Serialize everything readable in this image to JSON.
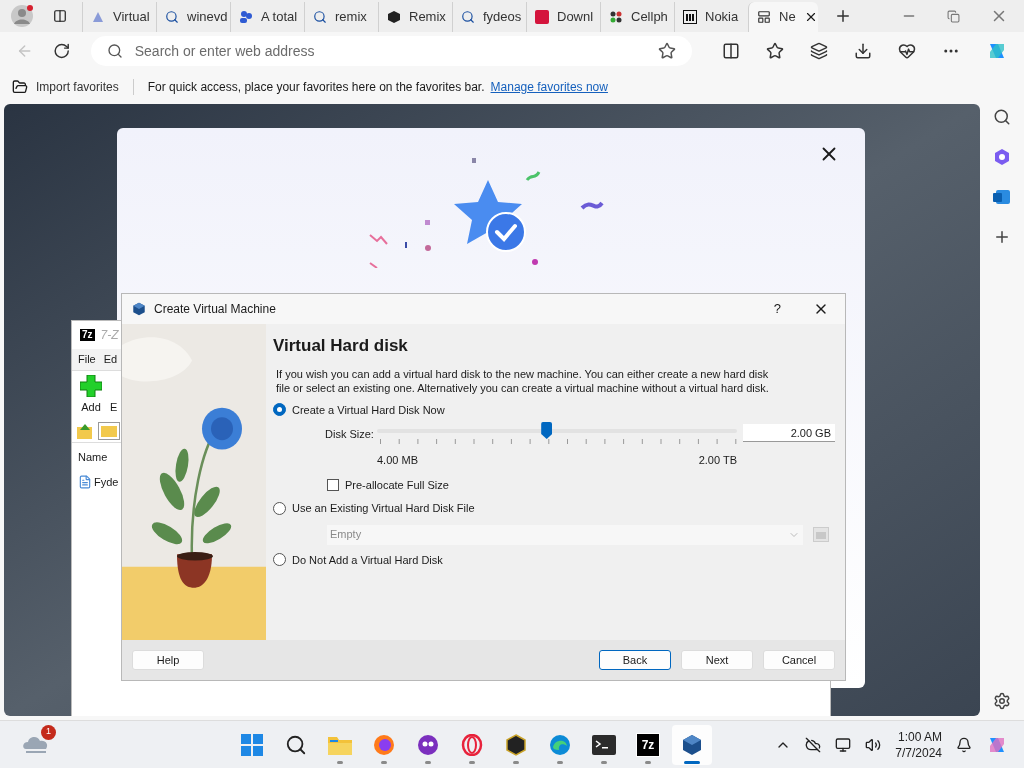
{
  "browser": {
    "tabs": [
      {
        "label": "Virtual",
        "kind": "page",
        "selected": false
      },
      {
        "label": "winevd",
        "kind": "search",
        "selected": false
      },
      {
        "label": "A total",
        "kind": "people",
        "selected": false
      },
      {
        "label": "remix",
        "kind": "search",
        "selected": false
      },
      {
        "label": "Remix",
        "kind": "cube",
        "selected": false
      },
      {
        "label": "fydeos",
        "kind": "search",
        "selected": false
      },
      {
        "label": "Downl",
        "kind": "brand",
        "selected": false
      },
      {
        "label": "Cellph",
        "kind": "dots",
        "selected": false
      },
      {
        "label": "Nokia",
        "kind": "columns",
        "selected": false
      },
      {
        "label": "Ne",
        "kind": "window",
        "selected": true
      }
    ],
    "address": {
      "placeholder": "Search or enter web address"
    },
    "favorites_bar": {
      "import": "Import favorites",
      "message": "For quick access, place your favorites here on the favorites bar.",
      "link": "Manage favorites now"
    }
  },
  "zip_window": {
    "logo": "7z",
    "title": "7-Z",
    "menu": [
      "File",
      "Ed"
    ],
    "toolbar": [
      "Add",
      "E"
    ],
    "column": "Name",
    "file": "Fyde"
  },
  "dialog": {
    "title": "Create Virtual Machine",
    "help_mark": "?",
    "heading": "Virtual Hard disk",
    "description": "If you wish you can add a virtual hard disk to the new machine. You can either create a new hard disk file or select an existing one. Alternatively you can create a virtual machine without a virtual hard disk.",
    "options": [
      {
        "label": "Create a Virtual Hard Disk Now",
        "selected": true
      },
      {
        "label": "Use an Existing Virtual Hard Disk File",
        "selected": false
      },
      {
        "label": "Do Not Add a Virtual Hard Disk",
        "selected": false
      }
    ],
    "disk_size": {
      "label": "Disk Size:",
      "level": 0.47,
      "min": "4.00 MB",
      "max": "2.00 TB",
      "value": "2.00 GB"
    },
    "preallocate": {
      "label": "Pre-allocate Full Size",
      "checked": false
    },
    "existing_file": {
      "value": "Empty",
      "disabled": true
    },
    "buttons": [
      {
        "label": "Help",
        "default": false
      },
      {
        "label": "Back",
        "default": true
      },
      {
        "label": "Next",
        "default": false
      },
      {
        "label": "Cancel",
        "default": false
      }
    ]
  },
  "taskbar": {
    "weather_badge": "1",
    "apps": [
      {
        "kind": "windows",
        "selected": false
      },
      {
        "kind": "search",
        "selected": false
      },
      {
        "kind": "folder",
        "selected": false
      },
      {
        "kind": "firefox",
        "selected": false
      },
      {
        "kind": "purple",
        "selected": false
      },
      {
        "kind": "opera",
        "selected": false
      },
      {
        "kind": "badge",
        "selected": false
      },
      {
        "kind": "edge",
        "selected": false
      },
      {
        "kind": "terminal",
        "selected": false
      },
      {
        "kind": "zip",
        "label": "7z",
        "selected": false
      },
      {
        "kind": "vbox",
        "selected": true
      }
    ],
    "time": "1:00 AM",
    "date": "7/7/2024"
  }
}
